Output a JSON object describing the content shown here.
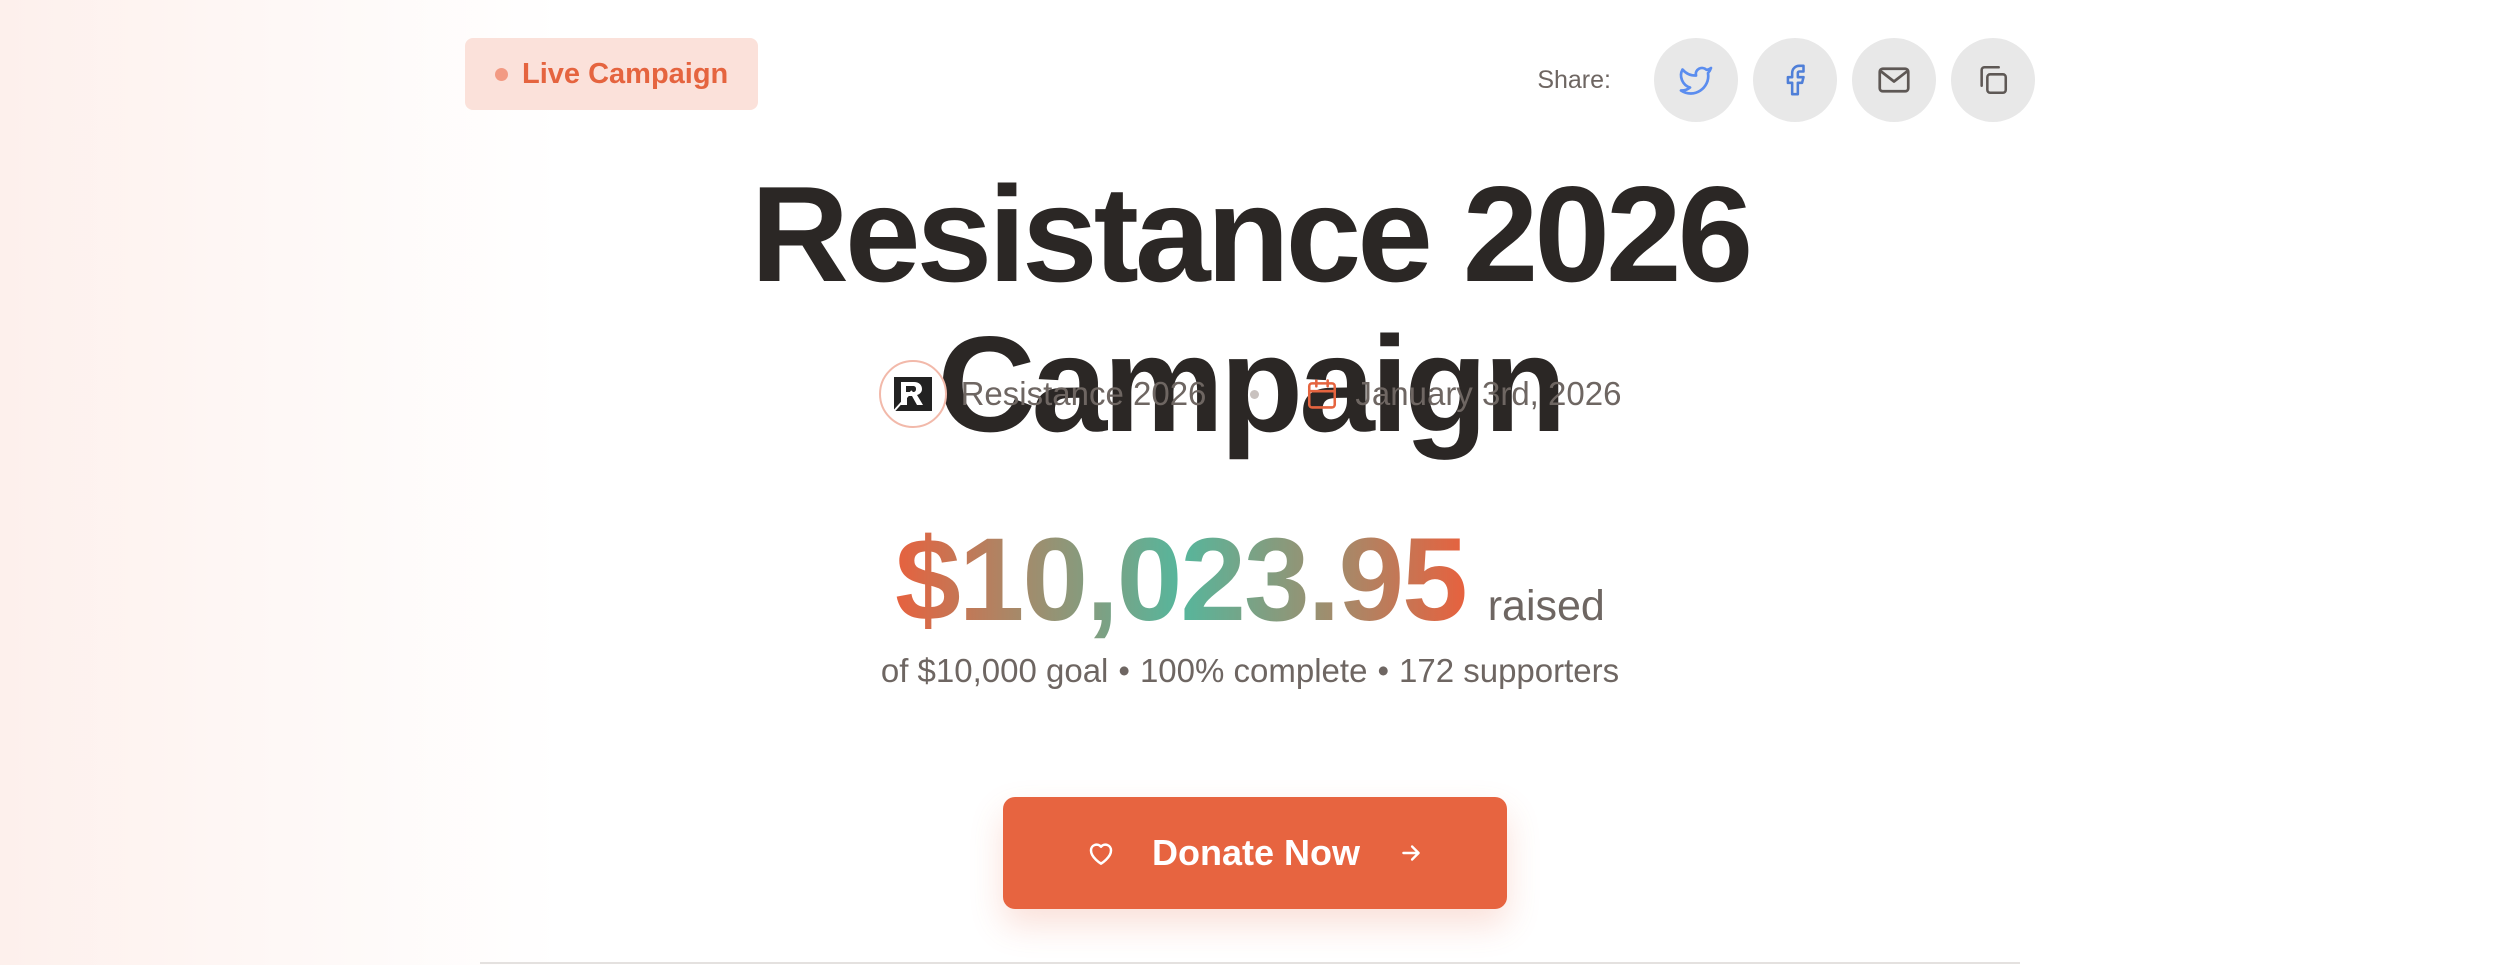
{
  "badge": {
    "label": "Live Campaign"
  },
  "share": {
    "label": "Share:",
    "buttons": [
      {
        "icon": "twitter-icon"
      },
      {
        "icon": "facebook-icon"
      },
      {
        "icon": "mail-icon"
      },
      {
        "icon": "copy-icon"
      }
    ]
  },
  "campaign": {
    "title": "Resistance 2026 Campaign",
    "organizer": "Resistance 2026",
    "date": "January 3rd, 2026"
  },
  "funding": {
    "amount": "$10,023.95",
    "raised_label": "raised",
    "goal_text": "of $10,000 goal",
    "percent_text": "100% complete",
    "supporters_text": "172 supporters",
    "separator": "•",
    "progress_fraction": 1.0
  },
  "cta": {
    "label": "Donate Now"
  },
  "colors": {
    "accent": "#e76440",
    "badge_bg": "#fbe1da",
    "gradient_green": "#56b69c",
    "text_muted": "#6e6662"
  }
}
